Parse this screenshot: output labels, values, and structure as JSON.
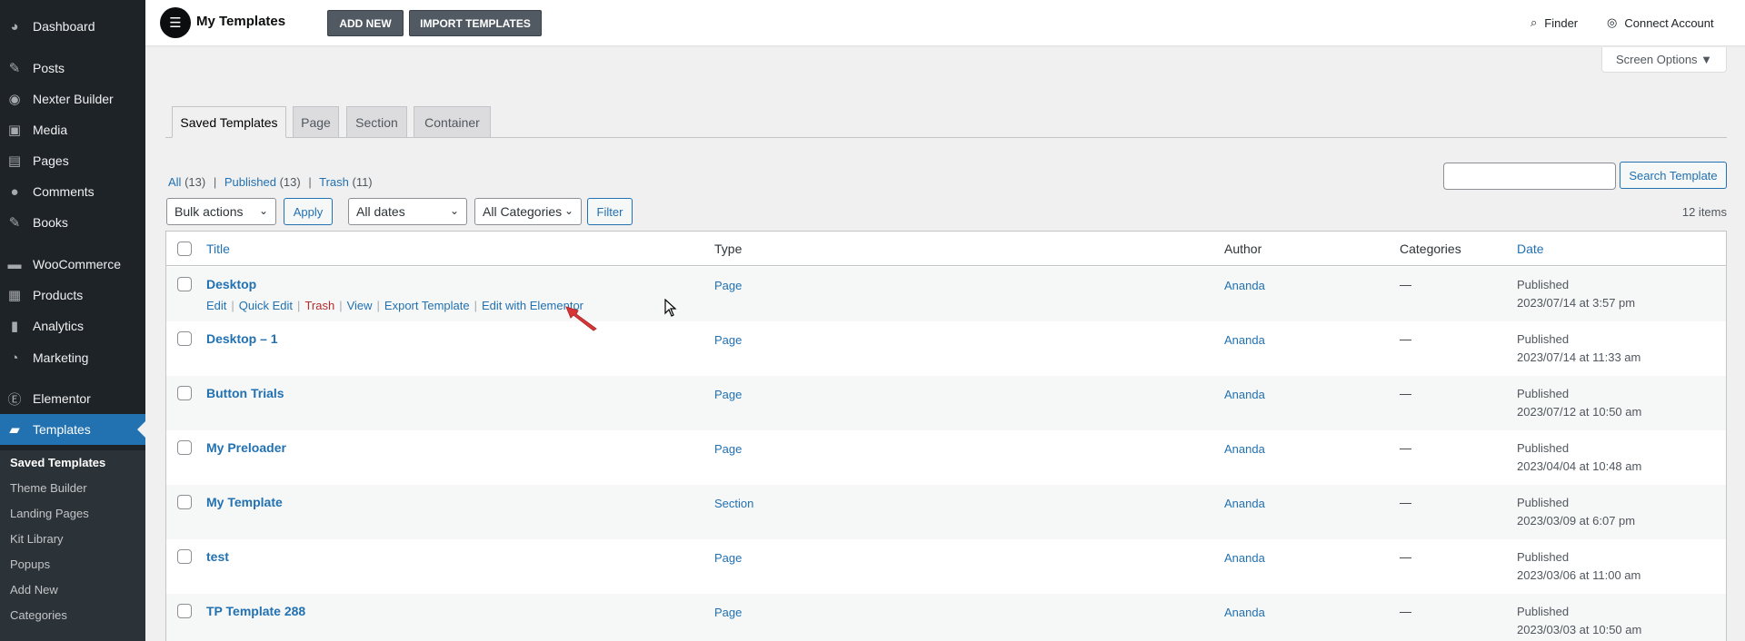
{
  "sidebar": {
    "items": [
      {
        "label": "Dashboard",
        "icon": "dashboard-icon",
        "glyph": "◕"
      },
      {
        "label": "Posts",
        "icon": "pushpin-icon",
        "glyph": "✎"
      },
      {
        "label": "Nexter Builder",
        "icon": "nexter-icon",
        "glyph": "◉"
      },
      {
        "label": "Media",
        "icon": "media-icon",
        "glyph": "▣"
      },
      {
        "label": "Pages",
        "icon": "pages-icon",
        "glyph": "▤"
      },
      {
        "label": "Comments",
        "icon": "comments-icon",
        "glyph": "●"
      },
      {
        "label": "Books",
        "icon": "pushpin-icon",
        "glyph": "✎"
      },
      {
        "label": "WooCommerce",
        "icon": "woocommerce-icon",
        "glyph": "▬"
      },
      {
        "label": "Products",
        "icon": "products-icon",
        "glyph": "▦"
      },
      {
        "label": "Analytics",
        "icon": "analytics-icon",
        "glyph": "▮"
      },
      {
        "label": "Marketing",
        "icon": "marketing-icon",
        "glyph": "◔"
      },
      {
        "label": "Elementor",
        "icon": "elementor-icon",
        "glyph": "Ⓔ"
      },
      {
        "label": "Templates",
        "icon": "folder-icon",
        "glyph": "▰"
      }
    ],
    "submenu": [
      "Saved Templates",
      "Theme Builder",
      "Landing Pages",
      "Kit Library",
      "Popups",
      "Add New",
      "Categories"
    ]
  },
  "topbar": {
    "title": "My Templates",
    "add_new": "ADD NEW",
    "import": "IMPORT TEMPLATES",
    "finder": "Finder",
    "connect": "Connect Account"
  },
  "screen_options": "Screen Options ▼",
  "tabs": [
    "Saved Templates",
    "Page",
    "Section",
    "Container"
  ],
  "filters": {
    "all": "All",
    "all_count": "(13)",
    "published": "Published",
    "published_count": "(13)",
    "trash": "Trash",
    "trash_count": "(11)",
    "sep": "|",
    "search_button": "Search Template",
    "bulk_actions": "Bulk actions",
    "apply": "Apply",
    "all_dates": "All dates",
    "all_categories": "All Categories",
    "filter": "Filter",
    "items_count": "12 items"
  },
  "table": {
    "headers": {
      "title": "Title",
      "type": "Type",
      "author": "Author",
      "categories": "Categories",
      "date": "Date"
    },
    "row_actions": {
      "edit": "Edit",
      "quick_edit": "Quick Edit",
      "trash": "Trash",
      "view": "View",
      "export": "Export Template",
      "edit_elementor": "Edit with Elementor",
      "sep": "|"
    },
    "rows": [
      {
        "title": "Desktop",
        "type": "Page",
        "author": "Ananda",
        "categories": "—",
        "status": "Published",
        "date": "2023/07/14 at 3:57 pm"
      },
      {
        "title": "Desktop – 1",
        "type": "Page",
        "author": "Ananda",
        "categories": "—",
        "status": "Published",
        "date": "2023/07/14 at 11:33 am"
      },
      {
        "title": "Button Trials",
        "type": "Page",
        "author": "Ananda",
        "categories": "—",
        "status": "Published",
        "date": "2023/07/12 at 10:50 am"
      },
      {
        "title": "My Preloader",
        "type": "Page",
        "author": "Ananda",
        "categories": "—",
        "status": "Published",
        "date": "2023/04/04 at 10:48 am"
      },
      {
        "title": "My Template",
        "type": "Section",
        "author": "Ananda",
        "categories": "—",
        "status": "Published",
        "date": "2023/03/09 at 6:07 pm"
      },
      {
        "title": "test",
        "type": "Page",
        "author": "Ananda",
        "categories": "—",
        "status": "Published",
        "date": "2023/03/06 at 11:00 am"
      },
      {
        "title": "TP Template 288",
        "type": "Page",
        "author": "Ananda",
        "categories": "—",
        "status": "Published",
        "date": "2023/03/03 at 10:50 am"
      }
    ]
  },
  "icons": {
    "logo": "elementor-logo-icon",
    "logo_glyph": "☰",
    "search": "search-icon",
    "search_glyph": "⌕",
    "account": "account-icon",
    "account_glyph": "◎",
    "chevron": "chevron-down-icon",
    "chevron_glyph": "⌄"
  },
  "colors": {
    "accent": "#2271b1",
    "sidebar": "#1d2327",
    "active": "#2271b1",
    "trash": "#b32d2e",
    "arrow": "#d63638"
  }
}
